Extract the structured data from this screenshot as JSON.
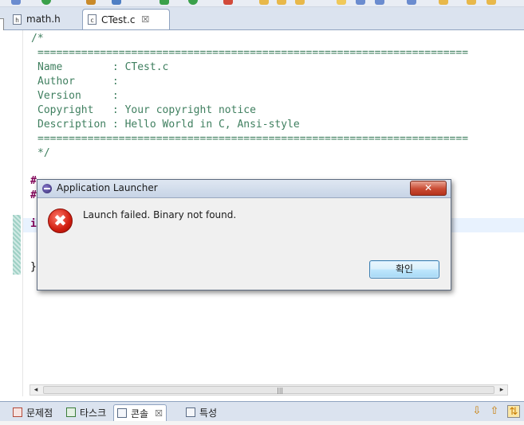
{
  "tabs": [
    {
      "label": "math.h",
      "icon": "header-file-icon",
      "icon_glyph": "h"
    },
    {
      "label": "CTest.c",
      "icon": "c-file-icon",
      "icon_glyph": "c",
      "close_glyph": "☒"
    }
  ],
  "editor": {
    "lines": [
      "/*",
      "=====================================================================",
      "Name        : CTest.c",
      "Author      :",
      "Version     :",
      "Copyright   : Your copyright notice",
      "Description : Hello World in C, Ansi-style",
      "=====================================================================",
      "*/"
    ],
    "partial_hash_1": "#",
    "partial_hash_2": "#",
    "partial_kw": "i",
    "partial_brace": "}"
  },
  "scrollbar": {
    "left": "◂",
    "right": "▸",
    "grip": "|||"
  },
  "views": {
    "problems": "문제점",
    "tasks": "타스크",
    "console": "콘솔",
    "console_close": "☒",
    "properties": "특성"
  },
  "dialog": {
    "title": "Application Launcher",
    "close_glyph": "✕",
    "message": "Launch failed. Binary not found.",
    "ok_label": "확인",
    "error_glyph": "✖"
  },
  "colors": {
    "comment": "#3f7f5f",
    "keyword": "#7f0055",
    "error_red": "#d01e10"
  }
}
